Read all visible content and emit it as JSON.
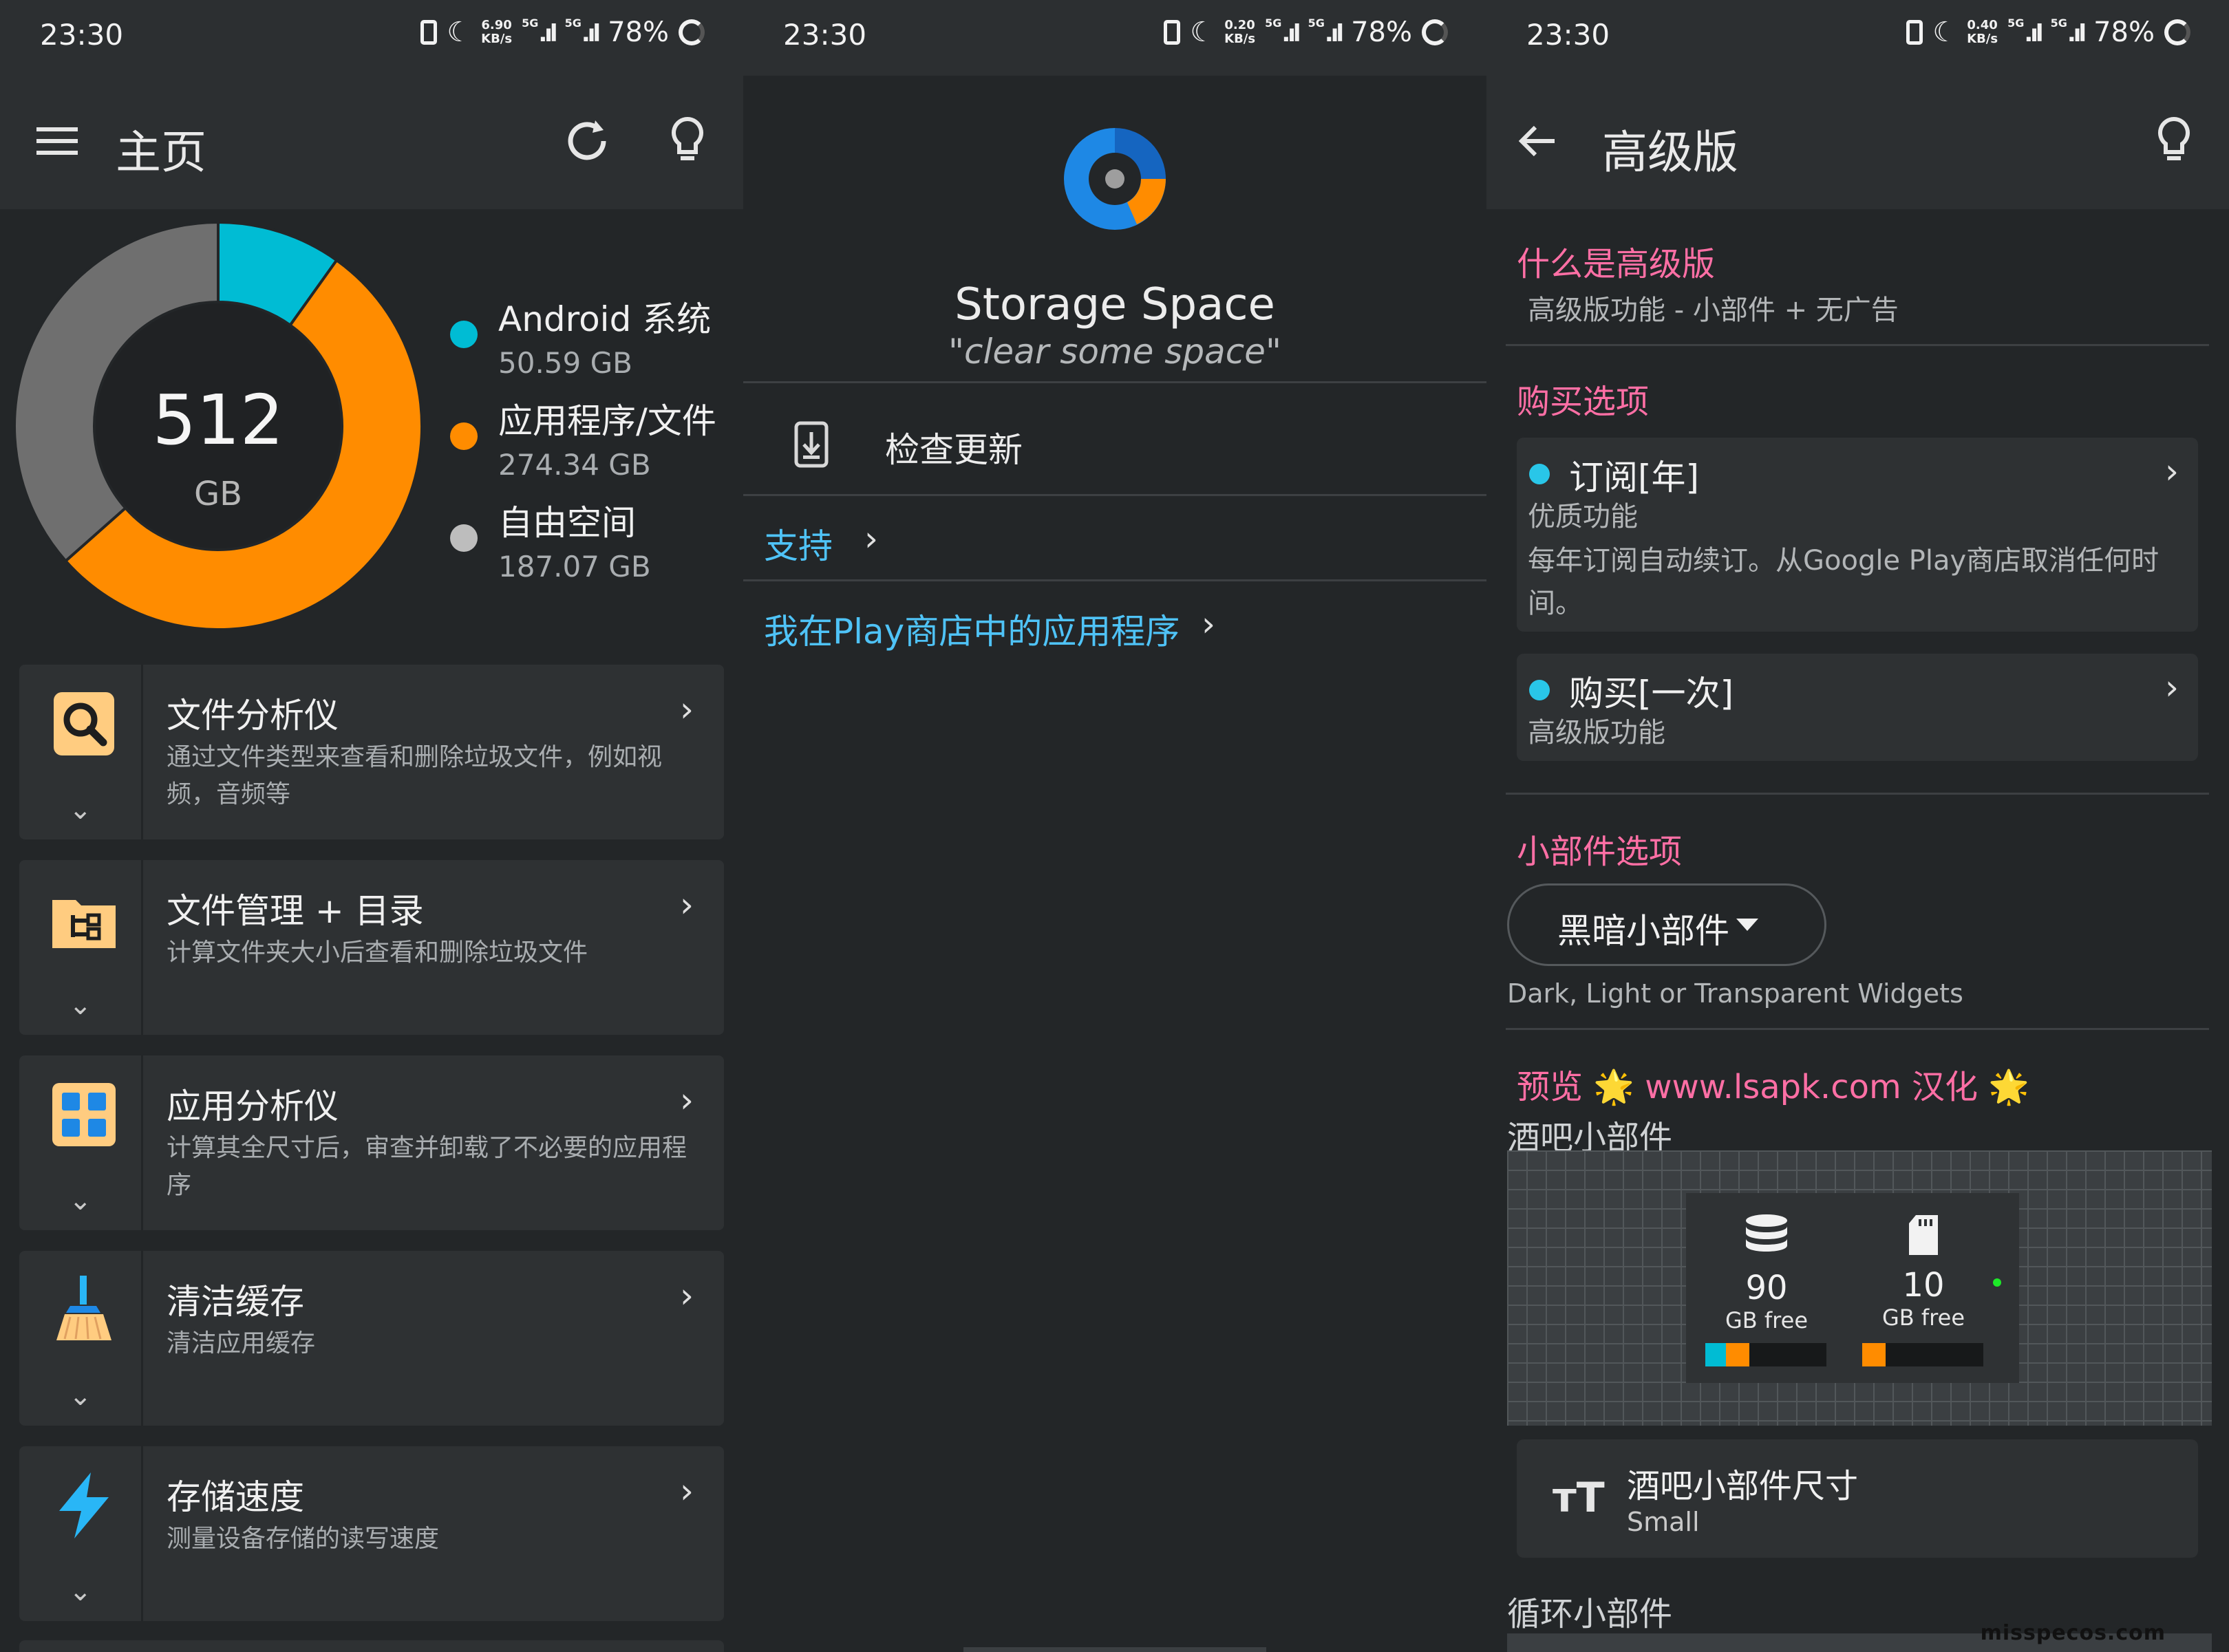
{
  "status_bar": {
    "time": "23:30",
    "p1_speed": [
      "6.90",
      "KB/s"
    ],
    "p2_speed": [
      "0.20",
      "KB/s"
    ],
    "p3_speed": [
      "0.40",
      "KB/s"
    ],
    "network": "5G",
    "battery": "78%"
  },
  "home": {
    "title": "主页",
    "storage_total": "512",
    "storage_unit": "GB",
    "legend": [
      {
        "name": "Android 系统",
        "size": "50.59 GB",
        "color": "#00bcd4"
      },
      {
        "name": "应用程序/文件",
        "size": "274.34 GB",
        "color": "#ff8c00"
      },
      {
        "name": "自由空间",
        "size": "187.07 GB",
        "color": "#bdbdbd"
      }
    ],
    "chart_data": {
      "type": "pie",
      "categories": [
        "Android 系统",
        "应用程序/文件",
        "自由空间"
      ],
      "values": [
        50.59,
        274.34,
        187.07
      ],
      "colors": [
        "#00bcd4",
        "#ff8c00",
        "#6f6f6f"
      ]
    },
    "cards": [
      {
        "title": "文件分析仪",
        "desc": "通过文件类型来查看和删除垃圾文件，例如视频，音频等",
        "icon": "search-icon"
      },
      {
        "title": "文件管理 + 目录",
        "desc": "计算文件夹大小后查看和删除垃圾文件",
        "icon": "folder-tree-icon"
      },
      {
        "title": "应用分析仪",
        "desc": "计算其全尺寸后，审查并卸载了不必要的应用程序",
        "icon": "apps-grid-icon"
      },
      {
        "title": "清洁缓存",
        "desc": "清洁应用缓存",
        "icon": "broom-icon"
      },
      {
        "title": "存储速度",
        "desc": "测量设备存储的读写速度",
        "icon": "lightning-icon"
      }
    ]
  },
  "about": {
    "app_name": "Storage Space",
    "tagline": "\"clear some space\"",
    "check_update": "检查更新",
    "support": "支持",
    "my_apps": "我在Play商店中的应用程序",
    "link_color": "#4fc3f7"
  },
  "premium": {
    "title": "高级版",
    "what_title": "什么是高级版",
    "what_desc": "高级版功能 - 小部件 + 无广告",
    "buy_title": "购买选项",
    "options": [
      {
        "title": "订阅[年]",
        "line1": "优质功能",
        "line2": "每年订阅自动续订。从Google Play商店取消任何时间。"
      },
      {
        "title": "购买[一次]",
        "line1": "高级版功能",
        "line2": ""
      }
    ],
    "widget_title": "小部件选项",
    "widget_dropdown": "黑暗小部件",
    "widget_desc": "Dark, Light or Transparent Widgets",
    "preview_title": "预览 🌟 www.lsapk.com 汉化 🌟",
    "bar_widget_title": "酒吧小部件",
    "widget_internal_num": "90",
    "widget_sd_num": "10",
    "widget_free_label": "GB free",
    "size_title": "酒吧小部件尺寸",
    "size_value": "Small",
    "loop_widget_title": "循环小部件",
    "accent": "#ff6fa5"
  },
  "watermark": "misspecos.com"
}
